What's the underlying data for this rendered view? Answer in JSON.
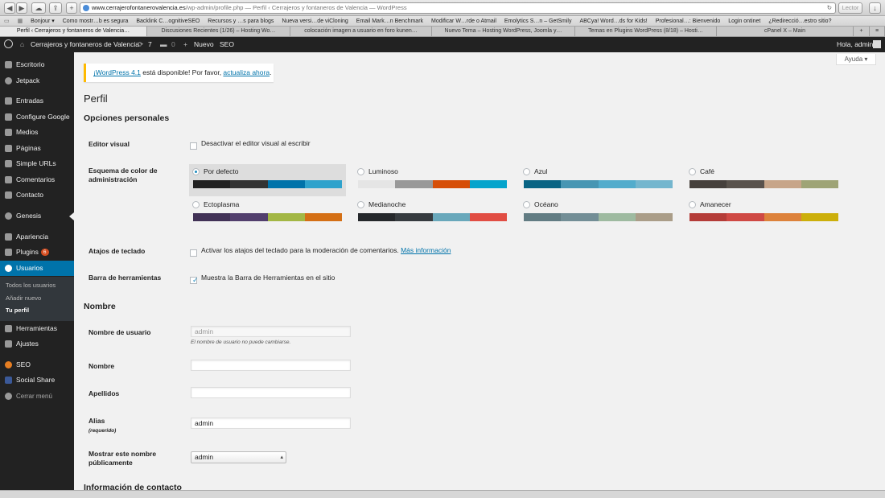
{
  "browser": {
    "url_host": "www.cerrajerofontanerovalencia.es",
    "url_path": "/wp-admin/profile.php",
    "url_title": " — Perfil ‹ Cerrajeros y fontaneros de Valencia — WordPress",
    "reader_label": "Lector",
    "bookmarks": [
      "Bonjour ▾",
      "Como mostr…b es segura",
      "Backlink C…ognitiveSEO",
      "Recursos y …s para blogs",
      "Nueva versi…de viCloning",
      "Email Mark…n Benchmark",
      "Modificar W…rde o Atmail",
      "Emolytics S…n – GetSmily",
      "ABCya! Word…ds for Kids!",
      "Profesional…: Bienvenido",
      "Login ontinet",
      "¿Redirecció…estro sitio?"
    ],
    "tabs": [
      "Perfil ‹ Cerrajeros y fontaneros de Valencia…",
      "Discusiones Recientes (1/26) – Hosting Wo…",
      "colocación imagen a usuario en foro kunen…",
      "Nuevo Tema – Hosting WordPress, Joomla y…",
      "Temas en Plugins WordPress (8/18) – Hosti…",
      "cPanel X – Main"
    ]
  },
  "adminbar": {
    "site_name": "Cerrajeros y fontaneros de Valencia",
    "updates_count": "7",
    "comments_count": "0",
    "new_label": "Nuevo",
    "seo_label": "SEO",
    "greeting": "Hola, admin"
  },
  "sidebar": {
    "items": [
      "Escritorio",
      "Jetpack",
      "Entradas",
      "Configure Google",
      "Medios",
      "Páginas",
      "Simple URLs",
      "Comentarios",
      "Contacto",
      "Genesis",
      "Apariencia",
      "Plugins",
      "Usuarios",
      "Herramientas",
      "Ajustes",
      "SEO",
      "Social Share",
      "Cerrar menú"
    ],
    "plugins_badge": "6",
    "sub_items": [
      "Todos los usuarios",
      "Añadir nuevo",
      "Tu perfil"
    ]
  },
  "main": {
    "help_label": "Ayuda ▾",
    "notice_link": "¡WordPress 4.1",
    "notice_mid": " está disponible! Por favor, ",
    "notice_link2": "actualiza ahora",
    "notice_end": ".",
    "page_title": "Perfil",
    "section_personal": "Opciones personales",
    "visual_editor_label": "Editor visual",
    "visual_editor_text": "Desactivar el editor visual al escribir",
    "color_scheme_label": "Esquema de color de administración",
    "schemes": [
      {
        "name": "Por defecto",
        "colors": [
          "#222222",
          "#333333",
          "#0073aa",
          "#2ea2cc"
        ],
        "selected": true
      },
      {
        "name": "Luminoso",
        "colors": [
          "#e5e5e5",
          "#999999",
          "#d64e07",
          "#04a4cc"
        ],
        "selected": false
      },
      {
        "name": "Azul",
        "colors": [
          "#096484",
          "#4796b3",
          "#52accc",
          "#74b6ce"
        ],
        "selected": false
      },
      {
        "name": "Café",
        "colors": [
          "#46403c",
          "#59524c",
          "#c7a589",
          "#9ea476"
        ],
        "selected": false
      },
      {
        "name": "Ectoplasma",
        "colors": [
          "#413256",
          "#523f6d",
          "#a3b745",
          "#d46f15"
        ],
        "selected": false
      },
      {
        "name": "Medianoche",
        "colors": [
          "#25282b",
          "#363b3f",
          "#69a8bb",
          "#e14d43"
        ],
        "selected": false
      },
      {
        "name": "Océano",
        "colors": [
          "#627c83",
          "#738e96",
          "#9ebaa0",
          "#aa9d88"
        ],
        "selected": false
      },
      {
        "name": "Amanecer",
        "colors": [
          "#b43c38",
          "#cf4944",
          "#dd823b",
          "#ccaf0b"
        ],
        "selected": false
      }
    ],
    "keyboard_label": "Atajos de teclado",
    "keyboard_text": "Activar los atajos del teclado para la moderación de comentarios.",
    "keyboard_link": "Más información",
    "toolbar_label": "Barra de herramientas",
    "toolbar_text": "Muestra la Barra de Herramientas en el sitio",
    "section_name": "Nombre",
    "username_label": "Nombre de usuario",
    "username_value": "admin",
    "username_desc": "El nombre de usuario no puede cambiarse.",
    "firstname_label": "Nombre",
    "firstname_value": "",
    "lastname_label": "Apellidos",
    "lastname_value": "",
    "nickname_label": "Alias",
    "nickname_required": "(requerido)",
    "nickname_value": "admin",
    "display_label_1": "Mostrar este nombre",
    "display_label_2": "públicamente",
    "display_value": "admin",
    "section_contact": "Información de contacto"
  }
}
